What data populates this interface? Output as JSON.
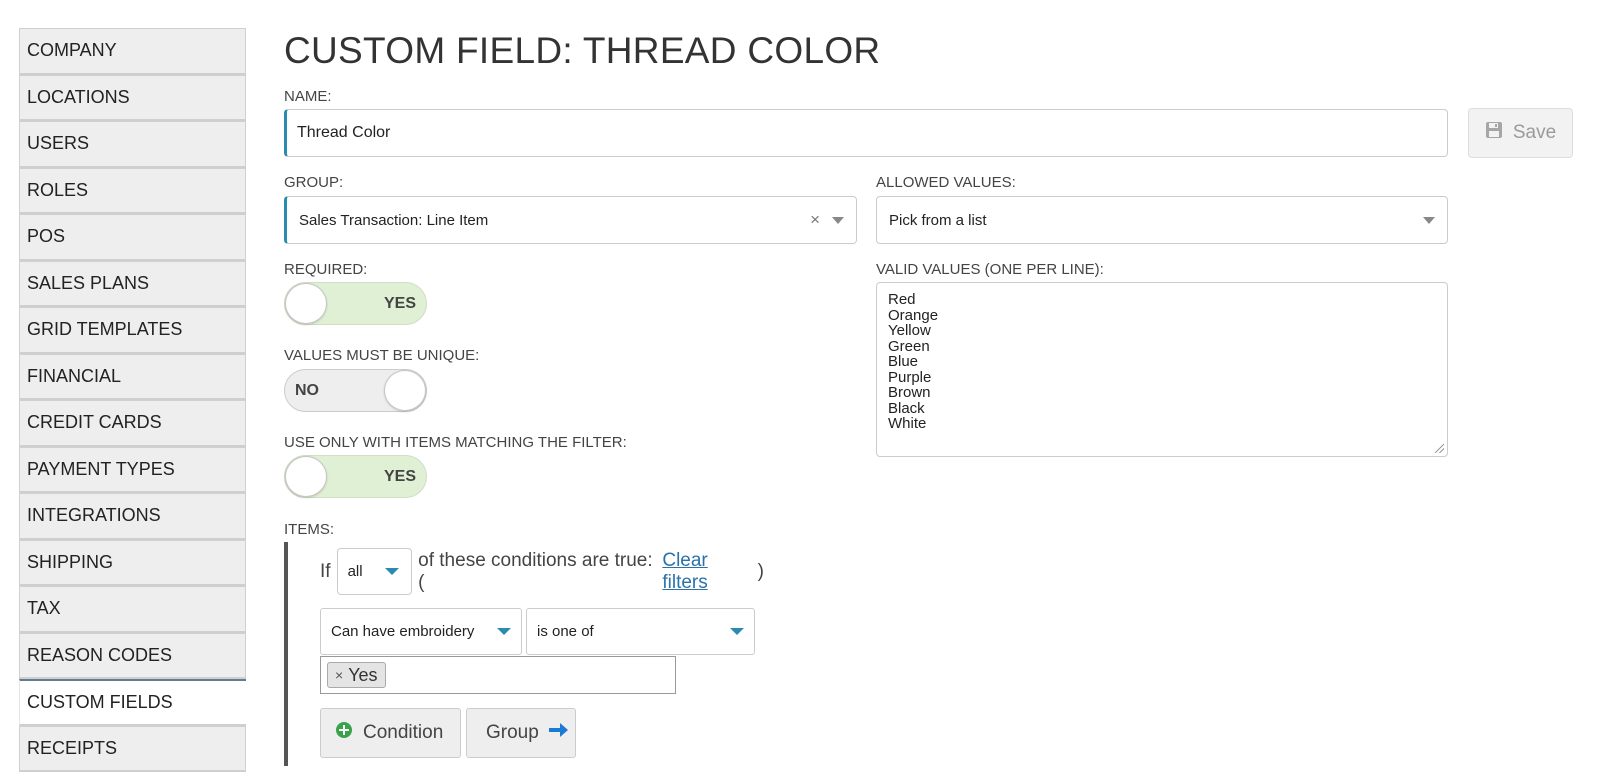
{
  "sidebar": {
    "items": [
      {
        "label": "COMPANY"
      },
      {
        "label": "LOCATIONS"
      },
      {
        "label": "USERS"
      },
      {
        "label": "ROLES"
      },
      {
        "label": "POS"
      },
      {
        "label": "SALES PLANS"
      },
      {
        "label": "GRID TEMPLATES"
      },
      {
        "label": "FINANCIAL"
      },
      {
        "label": "CREDIT CARDS"
      },
      {
        "label": "PAYMENT TYPES"
      },
      {
        "label": "INTEGRATIONS"
      },
      {
        "label": "SHIPPING"
      },
      {
        "label": "TAX"
      },
      {
        "label": "REASON CODES"
      },
      {
        "label": "CUSTOM FIELDS"
      },
      {
        "label": "RECEIPTS"
      }
    ],
    "active": "CUSTOM FIELDS"
  },
  "page": {
    "title": "CUSTOM FIELD: THREAD COLOR"
  },
  "form": {
    "name_label": "NAME:",
    "name_value": "Thread Color",
    "save_label": "Save",
    "group_label": "GROUP:",
    "group_value": "Sales Transaction: Line Item",
    "allowed_label": "ALLOWED VALUES:",
    "allowed_value": "Pick from a list",
    "required_label": "REQUIRED:",
    "required_state": "YES",
    "unique_label": "VALUES MUST BE UNIQUE:",
    "unique_state": "NO",
    "filter_label": "USE ONLY WITH ITEMS MATCHING THE FILTER:",
    "filter_state": "YES",
    "valid_values_label": "VALID VALUES (ONE PER LINE):",
    "valid_values": [
      "Red",
      "Orange",
      "Yellow",
      "Green",
      "Blue",
      "Purple",
      "Brown",
      "Black",
      "White"
    ]
  },
  "items": {
    "label": "ITEMS:",
    "if_text": "If",
    "match_value": "all",
    "conditions_text": "of these conditions are true: (",
    "clear_filters": "Clear filters",
    "close_paren": ")",
    "field_value": "Can have embroidery",
    "operator_value": "is one of",
    "tag_value": "Yes",
    "add_condition_label": "Condition",
    "add_group_label": "Group"
  },
  "colors": {
    "accent": "#2a8bb0",
    "toggle_on": "#e0f0d4",
    "add_icon": "#3aa24a",
    "arrow_icon": "#1a7ad4"
  }
}
